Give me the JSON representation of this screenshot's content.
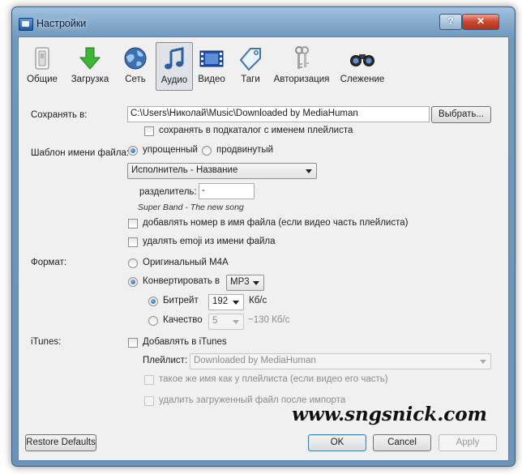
{
  "window": {
    "title": "Настройки",
    "help_label": "?",
    "close_label": "✕"
  },
  "toolbar": {
    "items": [
      {
        "label": "Общие",
        "icon": "switch-icon"
      },
      {
        "label": "Загрузка",
        "icon": "download-arrow-icon"
      },
      {
        "label": "Сеть",
        "icon": "globe-icon"
      },
      {
        "label": "Аудио",
        "icon": "music-note-icon",
        "active": true
      },
      {
        "label": "Видео",
        "icon": "film-strip-icon"
      },
      {
        "label": "Таги",
        "icon": "tag-icon"
      },
      {
        "label": "Авторизация",
        "icon": "keys-icon"
      },
      {
        "label": "Слежение",
        "icon": "binoculars-icon"
      }
    ]
  },
  "save": {
    "label": "Сохранять в:",
    "path": "C:\\Users\\Николай\\Music\\Downloaded by MediaHuman",
    "browse_label": "Выбрать...",
    "subfolder_label": "сохранять в подкаталог с именем плейлиста"
  },
  "template": {
    "label": "Шаблон имени файла:",
    "simple_label": "упрощенный",
    "advanced_label": "продвинутый",
    "pattern": "Исполнитель - Название",
    "separator_label": "разделитель:",
    "separator_value": "-",
    "example": "Super Band - The new song",
    "add_number_label": "добавлять номер в имя файла (если видео часть плейлиста)",
    "remove_emoji_label": "удалять emoji из имени файла"
  },
  "format": {
    "label": "Формат:",
    "original_label": "Оригинальный M4A",
    "convert_label": "Конвертировать в",
    "convert_value": "MP3",
    "bitrate_label": "Битрейт",
    "bitrate_value": "192",
    "bitrate_unit": "Кб/с",
    "quality_label": "Качество",
    "quality_value": "5",
    "quality_hint": "~130 Кб/с"
  },
  "itunes": {
    "label": "iTunes:",
    "add_label": "Добавлять в iTunes",
    "playlist_label": "Плейлист:",
    "playlist_value": "Downloaded by MediaHuman",
    "same_name_label": "такое же имя как у плейлиста (если видео его часть)",
    "delete_label": "удалить загруженный файл после импорта"
  },
  "footer": {
    "restore_label": "Restore Defaults",
    "ok_label": "OK",
    "cancel_label": "Cancel",
    "apply_label": "Apply"
  },
  "watermark": "www.sngsnick.com"
}
